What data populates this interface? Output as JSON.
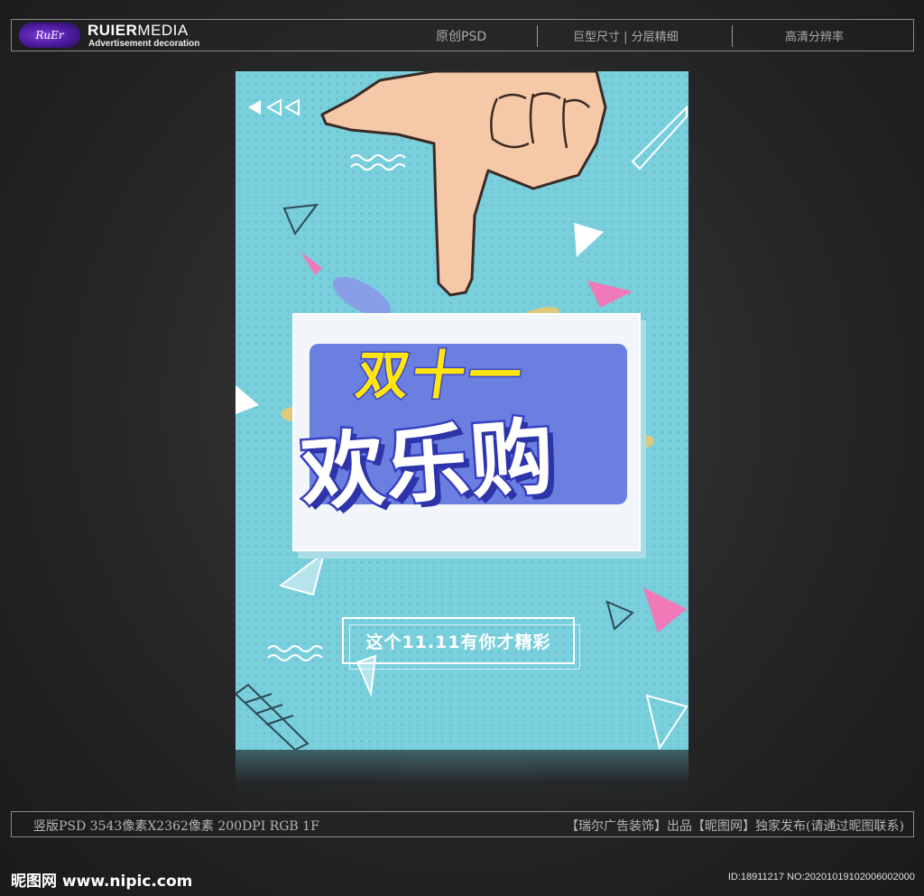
{
  "header": {
    "logo_mark": "RuEr",
    "brand_bold": "RUIER",
    "brand_light": "MEDIA",
    "brand_sub": "Advertisement decoration",
    "items": [
      "原创PSD",
      "巨型尺寸 | 分层精细",
      "高清分辨率"
    ]
  },
  "poster": {
    "title_top": "双十一",
    "title_main": "欢乐购",
    "slogan": "这个11.11有你才精彩",
    "colors": {
      "background": "#79cfdc",
      "title_yellow": "#ffe60f",
      "title_blue": "#3a40c4",
      "panel_blue": "#6b7fe0",
      "accent_pink": "#f07ab8"
    }
  },
  "footer": {
    "left": "竖版PSD 3543像素X2362像素 200DPI RGB 1F",
    "right": "【瑞尔广告装饰】出品【昵图网】独家发布(请通过昵图联系)",
    "watermark": "昵图网 www.nipic.com",
    "id": "ID:18911217 NO:20201019102006002000"
  }
}
